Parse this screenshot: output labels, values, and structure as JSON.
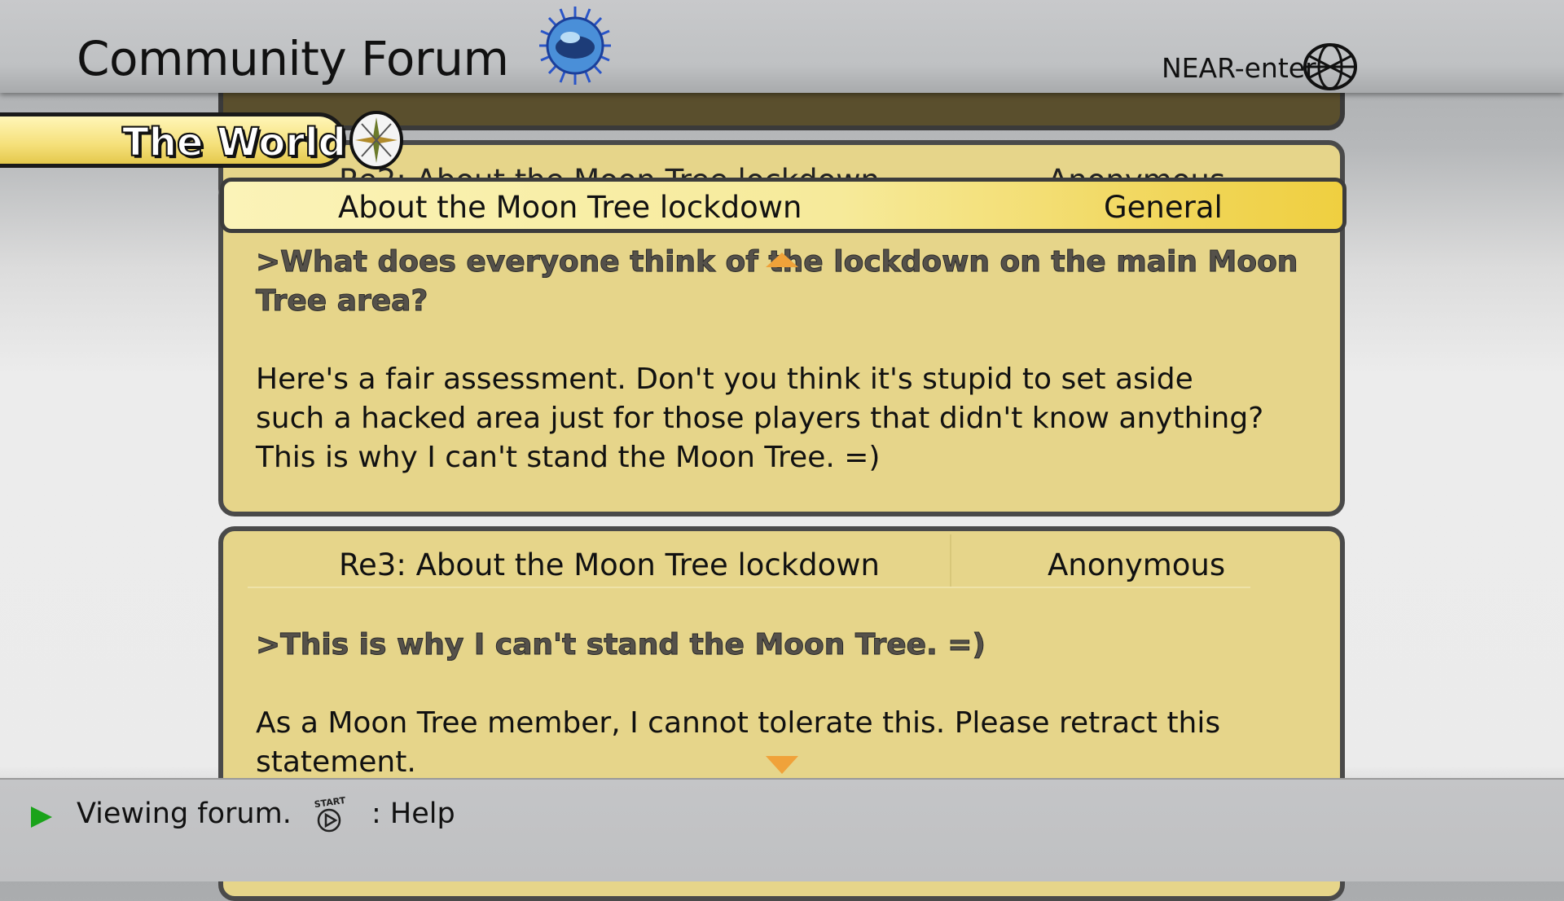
{
  "header": {
    "title": "Community Forum",
    "logo_icon": "spiked-globe-logo",
    "near_label": "NEAR-enter",
    "network_icon": "wireframe-globe-icon"
  },
  "tab": {
    "label": "The World",
    "icon": "compass-icon"
  },
  "posts": {
    "previous": {
      "subject": "Re2: About the Moon Tree lockdown",
      "author": "Anonymous"
    },
    "selected": {
      "subject": "About the Moon Tree lockdown",
      "category": "General",
      "quote_lines": [
        ">What does everyone think of the lockdown on the main Moon",
        "Tree area?"
      ],
      "body_lines": [
        "Here's a fair assessment. Don't you think it's stupid to set aside",
        "such a hacked area just for those players that didn't know anything?",
        "This is why I can't stand the Moon Tree. =)"
      ]
    },
    "next": {
      "subject": "Re3: About the Moon Tree lockdown",
      "author": "Anonymous",
      "quote_lines": [
        ">This is why I can't stand the Moon Tree. =)"
      ],
      "body_lines": [
        "As a Moon Tree member, I cannot tolerate this. Please retract this",
        "statement."
      ]
    }
  },
  "footer": {
    "status": "Viewing forum.",
    "start_icon_label": "START",
    "help": ": Help"
  },
  "colors": {
    "card_bg": "#e6d58a",
    "header_highlight": "#efcf40",
    "scroll_arrow": "#f0a23a",
    "status_arrow": "#1aa31a"
  }
}
